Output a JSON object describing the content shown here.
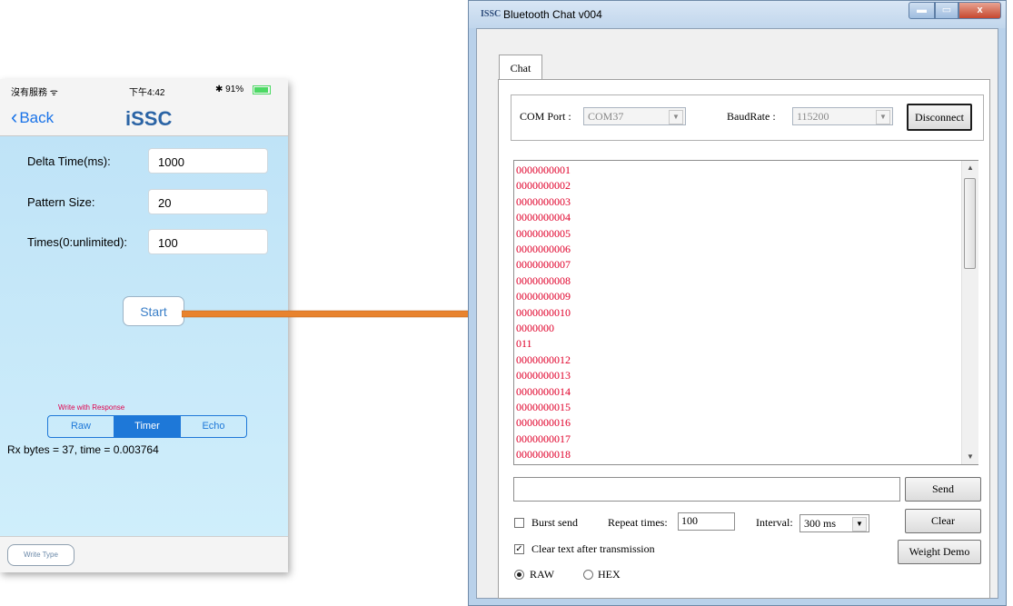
{
  "phone": {
    "status": {
      "carrier": "沒有服務 ᯤ",
      "time": "下午4:42",
      "battery": "✱ 91%"
    },
    "nav": {
      "back_label": "Back",
      "logo": "iSSC"
    },
    "fields": [
      {
        "label": "Delta Time(ms):",
        "value": "1000"
      },
      {
        "label": "Pattern Size:",
        "value": "20"
      },
      {
        "label": "Times(0:unlimited):",
        "value": "100"
      }
    ],
    "start_label": "Start",
    "write_response_label": "Write with Response",
    "segments": [
      "Raw",
      "Timer",
      "Echo"
    ],
    "selected_segment": "Timer",
    "rx_text": "Rx bytes = 37, time = 0.003764",
    "write_type_label": "Write Type"
  },
  "window": {
    "title": "Bluetooth Chat v004",
    "icon_text": "ISSC",
    "close_glyph": "x",
    "tab_label": "Chat",
    "com_port_label": "COM Port :",
    "com_port_value": "COM37",
    "baud_rate_label": "BaudRate :",
    "baud_rate_value": "115200",
    "disconnect_label": "Disconnect",
    "output_lines": [
      "0000000001",
      "0000000002",
      "0000000003",
      "0000000004",
      "0000000005",
      "0000000006",
      "0000000007",
      "0000000008",
      "0000000009",
      "0000000010",
      "0000000",
      "011",
      "0000000012",
      "0000000013",
      "0000000014",
      "0000000015",
      "0000000016",
      "0000000017",
      "0000000018"
    ],
    "send_label": "Send",
    "burst_send_label": "Burst send",
    "repeat_times_label": "Repeat times:",
    "repeat_times_value": "100",
    "interval_label": "Interval:",
    "interval_value": "300 ms",
    "clear_label": "Clear",
    "clear_after_label": "Clear text after transmission",
    "weight_demo_label": "Weight Demo",
    "raw_label": "RAW",
    "hex_label": "HEX"
  }
}
